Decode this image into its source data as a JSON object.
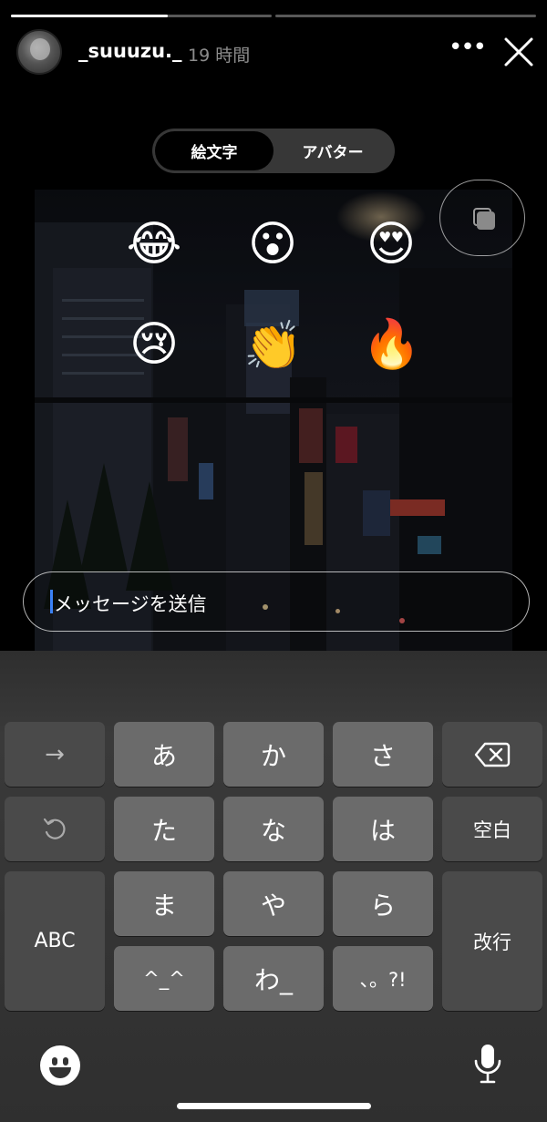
{
  "story": {
    "progress": [
      {
        "fill": 0.6
      },
      {
        "fill": 0.0
      }
    ],
    "username": "_suuuzu._",
    "time": "19 時間",
    "more_label": "•••"
  },
  "reaction_tabs": {
    "selected": "絵文字",
    "other": "アバター"
  },
  "emojis": [
    "😂",
    "😮",
    "😍",
    "😢",
    "👏",
    "🔥"
  ],
  "message": {
    "placeholder": "メッセージを送信"
  },
  "keyboard": {
    "row1": [
      "→",
      "あ",
      "か",
      "さ",
      "⌫"
    ],
    "row2": [
      "↺",
      "た",
      "な",
      "は",
      "空白"
    ],
    "row3": [
      "ABC",
      "ま",
      "や",
      "ら",
      "改行"
    ],
    "row4": [
      "^_^",
      "わ_",
      "、。?!"
    ]
  },
  "colors": {
    "caret": "#3b82f6",
    "key": "#6b6b6b",
    "key_dark": "#4a4a4a"
  }
}
